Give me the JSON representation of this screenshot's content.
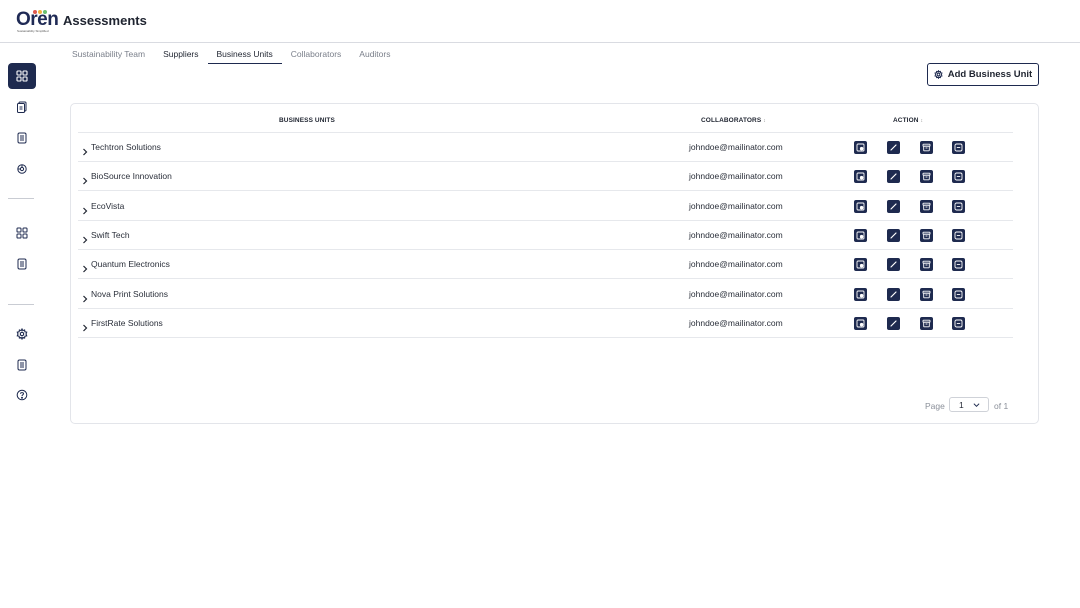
{
  "app": {
    "title": "Assessments",
    "logo_text": "Oren",
    "logo_tagline": "Sustainability Simplified"
  },
  "tabs": [
    {
      "label": "Sustainability Team"
    },
    {
      "label": "Suppliers"
    },
    {
      "label": "Business Units"
    },
    {
      "label": "Collaborators"
    },
    {
      "label": "Auditors"
    }
  ],
  "active_tab": "Business Units",
  "add_button": {
    "label": "Add Business Unit"
  },
  "table": {
    "headers": {
      "business_units": "BUSINESS UNITS",
      "collaborators": "COLLABORATORS",
      "action": "ACTION"
    },
    "rows": [
      {
        "name": "Techtron Solutions",
        "email": "johndoe@mailinator.com"
      },
      {
        "name": "BioSource Innovation",
        "email": "johndoe@mailinator.com"
      },
      {
        "name": "EcoVista",
        "email": "johndoe@mailinator.com"
      },
      {
        "name": "Swift Tech",
        "email": "johndoe@mailinator.com"
      },
      {
        "name": "Quantum Electronics",
        "email": "johndoe@mailinator.com"
      },
      {
        "name": "Nova Print Solutions",
        "email": "johndoe@mailinator.com"
      },
      {
        "name": "FirstRate Solutions",
        "email": "johndoe@mailinator.com"
      }
    ],
    "action_icons": [
      "view-icon",
      "edit-icon",
      "archive-icon",
      "minus-box-icon"
    ]
  },
  "pagination": {
    "page_label": "Page",
    "current": "1",
    "of_label": "of 1"
  },
  "colors": {
    "primary": "#1e2a4f",
    "logo_dots": [
      "#e05a4e",
      "#f2b33d",
      "#6cc070"
    ]
  }
}
